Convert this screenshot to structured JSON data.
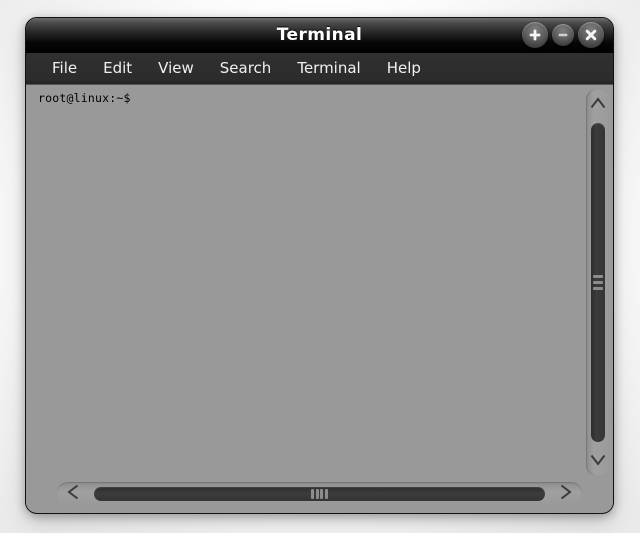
{
  "window": {
    "title": "Terminal",
    "controls": [
      {
        "name": "maximize-button",
        "icon": "plus-icon",
        "label": "+"
      },
      {
        "name": "minimize-button",
        "icon": "minus-icon",
        "label": "–"
      },
      {
        "name": "close-button",
        "icon": "close-icon",
        "label": "✕"
      }
    ]
  },
  "menubar": {
    "items": [
      {
        "label": "File"
      },
      {
        "label": "Edit"
      },
      {
        "label": "View"
      },
      {
        "label": "Search"
      },
      {
        "label": "Terminal"
      },
      {
        "label": "Help"
      }
    ]
  },
  "terminal": {
    "prompt": "root@linux:~$",
    "lines": [
      "root@linux:~$"
    ],
    "background_color": "#999999",
    "text_color": "#000000"
  },
  "scrollbars": {
    "vertical": {
      "up_arrow_icon": "chevron-up-icon",
      "down_arrow_icon": "chevron-down-icon",
      "grip_icon": "grip-horizontal-icon"
    },
    "horizontal": {
      "left_arrow_icon": "chevron-left-icon",
      "right_arrow_icon": "chevron-right-icon",
      "grip_icon": "grip-vertical-icon"
    }
  },
  "theme": {
    "titlebar_color": "#000000",
    "menubar_color": "#2e2e2e",
    "body_color": "#999999",
    "accent_text_color": "#ffffff",
    "scrollbar_track_color": "#9a9a9a",
    "scrollbar_thumb_color": "#353535"
  }
}
